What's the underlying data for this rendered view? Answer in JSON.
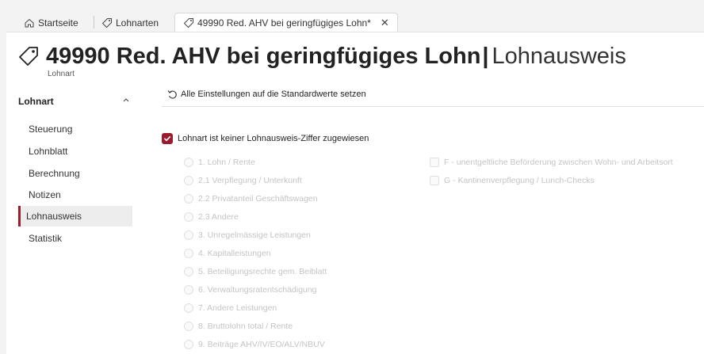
{
  "tabs": [
    {
      "label": "Startseite",
      "icon": "home-icon"
    },
    {
      "label": "Lohnarten",
      "icon": "tag-icon"
    },
    {
      "label": "49990 Red. AHV bei geringfügiges Lohn*",
      "icon": "tag-icon",
      "active": true
    }
  ],
  "header": {
    "title_bold": "49990 Red. AHV bei geringfügiges Lohn",
    "pipe": "|",
    "title_sub": "Lohnausweis",
    "subtitle": "Lohnart"
  },
  "sidebar": {
    "section": "Lohnart",
    "items": [
      {
        "label": "Steuerung"
      },
      {
        "label": "Lohnblatt"
      },
      {
        "label": "Berechnung"
      },
      {
        "label": "Notizen"
      },
      {
        "label": "Lohnausweis",
        "active": true
      },
      {
        "label": "Statistik"
      }
    ]
  },
  "content": {
    "reset_label": "Alle Einstellungen auf die Standardwerte setzen",
    "main_checkbox_label": "Lohnart ist keiner Lohnausweis-Ziffer zugewiesen",
    "main_checkbox_checked": true,
    "radio_options": [
      "1. Lohn / Rente",
      "2.1 Verpflegung / Unterkunft",
      "2.2 Privatanteil Geschäftswagen",
      "2.3 Andere",
      "3. Unregelmässige Leistungen",
      "4. Kapitalleistungen",
      "5. Beteiligungsrechte gem. Beiblatt",
      "6. Verwaltungsratentschädigung",
      "7. Andere Leistungen",
      "8. Bruttolohn total / Rente",
      "9. Beiträge AHV/IV/EO/ALV/NBUV"
    ],
    "checkbox_options": [
      "F - unentgeltliche Beförderung zwischen Wohn- und Arbeitsort",
      "G - Kantinenverpflegung / Lunch-Checks"
    ]
  },
  "colors": {
    "accent": "#9b1c2e"
  }
}
